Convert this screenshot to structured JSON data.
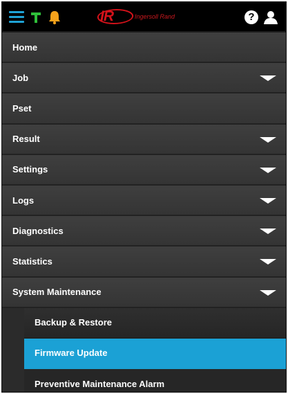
{
  "header": {
    "logo_mark": "IR",
    "logo_text": "Ingersoll Rand",
    "help_glyph": "?",
    "icons": [
      "menu-icon",
      "wrench-icon",
      "bell-icon",
      "help-icon",
      "user-icon"
    ],
    "colors": {
      "accent": "#1fa3d6",
      "wrench": "#2fbf3a",
      "bell": "#f6a21b",
      "brand_red": "#d3121a"
    }
  },
  "menu": {
    "items": [
      {
        "label": "Home",
        "expandable": false
      },
      {
        "label": "Job",
        "expandable": true
      },
      {
        "label": "Pset",
        "expandable": false
      },
      {
        "label": "Result",
        "expandable": true
      },
      {
        "label": "Settings",
        "expandable": true
      },
      {
        "label": "Logs",
        "expandable": true
      },
      {
        "label": "Diagnostics",
        "expandable": true
      },
      {
        "label": "Statistics",
        "expandable": true
      },
      {
        "label": "System Maintenance",
        "expandable": true,
        "expanded": true
      }
    ],
    "subitems": [
      {
        "label": "Backup & Restore",
        "active": false
      },
      {
        "label": "Firmware Update",
        "active": true
      },
      {
        "label": "Preventive Maintenance Alarm",
        "active": false
      }
    ],
    "active_color": "#1ba1d5"
  }
}
